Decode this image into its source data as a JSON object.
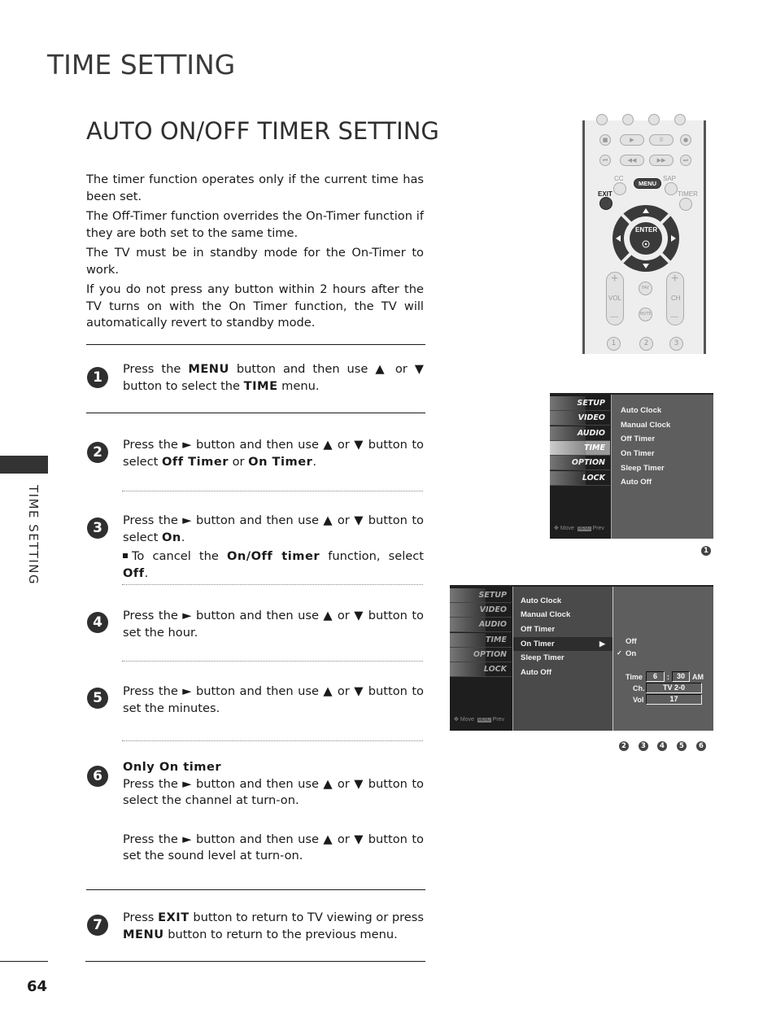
{
  "header": {
    "page_title": "TIME SETTING",
    "section_title": "AUTO ON/OFF TIMER SETTING"
  },
  "intro": [
    "The timer function operates only if the current time has been set.",
    "The Off-Timer function overrides the On-Timer function if they are both set to the same time.",
    "The TV must be in standby mode for the On-Timer to work.",
    "If you do not press any button within 2 hours after the TV turns on with the On Timer function, the TV will automatically revert to standby mode."
  ],
  "steps": [
    {
      "num": "1",
      "parts": [
        "Press the ",
        "MENU",
        " button and then use ▲ or ▼ button to select the ",
        "TIME",
        " menu."
      ]
    },
    {
      "num": "2",
      "parts": [
        "Press the ► button and then use ▲ or ▼ button to select ",
        "Off Timer",
        " or ",
        "On Timer",
        "."
      ]
    },
    {
      "num": "3",
      "parts": [
        "Press the ► button and then use ▲ or ▼ button to select ",
        "On",
        "."
      ],
      "note": [
        "To cancel the ",
        "On/Off timer",
        " function, select ",
        "Off",
        "."
      ]
    },
    {
      "num": "4",
      "text": "Press the ► button and then use ▲ or ▼ button to set the hour."
    },
    {
      "num": "5",
      "text": "Press the ► button and then use ▲ or ▼ button to set the minutes."
    },
    {
      "num": "6",
      "heading": "Only On timer",
      "text": "Press the ► button and then use ▲ or ▼ button to select the channel at turn-on.",
      "text2": "Press the ► button and then use ▲ or ▼ button to set the sound level at turn-on."
    },
    {
      "num": "7",
      "parts": [
        "Press ",
        "EXIT",
        " button to return to TV viewing or press ",
        "MENU",
        " button to return to the previous menu."
      ]
    }
  ],
  "sidebar": {
    "label": "TIME SETTING"
  },
  "footer": {
    "page_number": "64"
  },
  "remote": {
    "labels": {
      "cc": "CC",
      "menu": "MENU",
      "sap": "SAP",
      "exit": "EXIT",
      "timer": "TIMER",
      "enter": "ENTER",
      "vol": "VOL",
      "ch": "CH",
      "fav": "FAV",
      "mute": "MUTE",
      "plus": "+",
      "minus": "—"
    },
    "number_keys": [
      "1",
      "2",
      "3"
    ]
  },
  "osd1": {
    "categories": [
      "SETUP",
      "VIDEO",
      "AUDIO",
      "TIME",
      "OPTION",
      "LOCK"
    ],
    "active_category": "TIME",
    "items": [
      "Auto Clock",
      "Manual Clock",
      "Off Timer",
      "On Timer",
      "Sleep Timer",
      "Auto Off"
    ],
    "footer_move": "Move",
    "footer_prev": "Prev",
    "footer_prev_key": "MENU",
    "callout": "1"
  },
  "osd2": {
    "categories": [
      "SETUP",
      "VIDEO",
      "AUDIO",
      "TIME",
      "OPTION",
      "LOCK"
    ],
    "items": [
      "Auto Clock",
      "Manual Clock",
      "Off Timer",
      "On Timer",
      "Sleep Timer",
      "Auto Off"
    ],
    "selected_item": "On Timer",
    "options": [
      "Off",
      "On"
    ],
    "checked_option": "On",
    "check_mark": "✓",
    "time_label": "Time",
    "hour": "6",
    "colon": ":",
    "minute": "30",
    "ampm": "AM",
    "ch_label": "Ch.",
    "channel": "TV  2-0",
    "vol_label": "Vol",
    "volume": "17",
    "footer_move": "Move",
    "footer_prev": "Prev",
    "footer_prev_key": "MENU",
    "callouts": [
      "2",
      "3",
      "4",
      "5",
      "6"
    ]
  }
}
